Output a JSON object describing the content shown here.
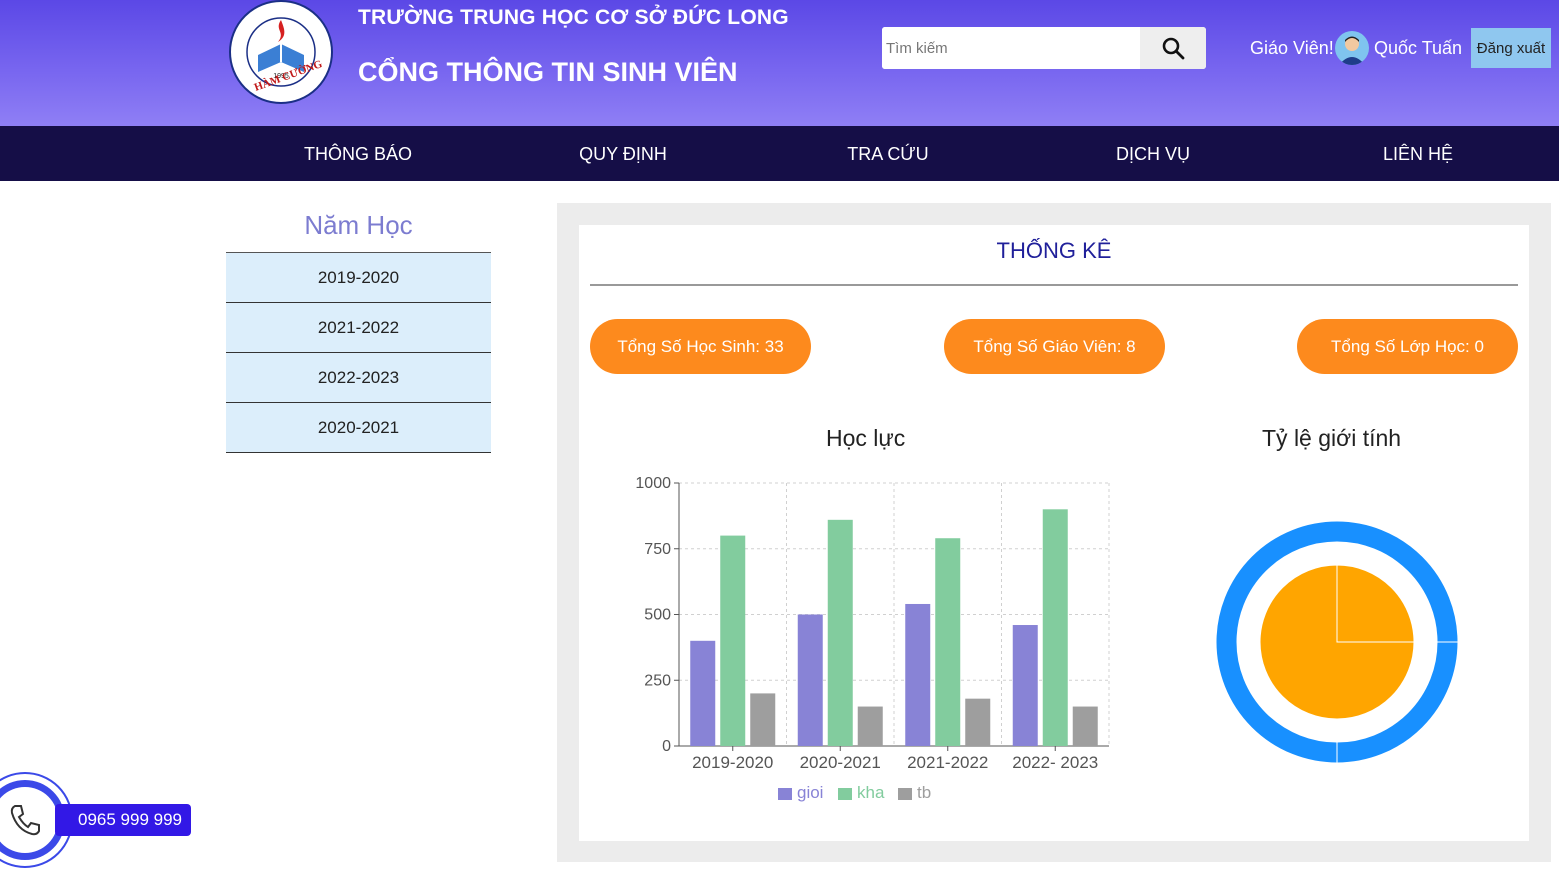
{
  "header": {
    "school_name": "TRƯỜNG TRUNG HỌC CƠ SỞ ĐỨC LONG",
    "portal_name": "CỔNG THÔNG TIN SINH VIÊN",
    "logo_text": "TRƯỜNG TRUNG HỌC CƠ SỞ HÀM CƯỜNG 1995",
    "search_placeholder": "Tìm kiếm",
    "greeting": "Giáo Viên!",
    "user_name": "Quốc Tuấn",
    "logout_label": "Đăng xuất"
  },
  "nav": {
    "items": [
      "THÔNG BÁO",
      "QUY ĐỊNH",
      "TRA CỨU",
      "DỊCH VỤ",
      "LIÊN HỆ"
    ]
  },
  "sidebar": {
    "title": "Năm Học",
    "years": [
      "2019-2020",
      "2021-2022",
      "2022-2023",
      "2020-2021"
    ]
  },
  "stats": {
    "title": "THỐNG KÊ",
    "students": "Tổng Số Học Sinh: 33",
    "teachers": "Tổng Số Giáo Viên: 8",
    "classes": "Tổng Số Lớp Học: 0"
  },
  "phone": {
    "number": "0965 999 999"
  },
  "colors": {
    "header_top": "#5b48e6",
    "navbar": "#150e47",
    "pill": "#fd8a1d",
    "gioi": "#8883d6",
    "kha": "#82cc9e",
    "tb": "#9e9e9e",
    "donut_outer": "#1890ff",
    "donut_inner": "#ffa500"
  },
  "chart_data": [
    {
      "type": "bar",
      "title": "Học lực",
      "categories": [
        "2019-2020",
        "2020-2021",
        "2021-2022",
        "2022- 2023"
      ],
      "series": [
        {
          "name": "gioi",
          "values": [
            400,
            500,
            540,
            460
          ]
        },
        {
          "name": "kha",
          "values": [
            800,
            860,
            790,
            900
          ]
        },
        {
          "name": "tb",
          "values": [
            200,
            150,
            180,
            150
          ]
        }
      ],
      "yticks": [
        "0",
        "250",
        "500",
        "750",
        "1000"
      ],
      "ylim": [
        0,
        1000
      ],
      "grid": true,
      "legend": "bottom"
    },
    {
      "type": "pie",
      "title": "Tỷ lệ giới tính",
      "rings": [
        {
          "name": "outer",
          "values": [
            1,
            3
          ]
        },
        {
          "name": "inner",
          "values": [
            3,
            1
          ]
        }
      ]
    }
  ]
}
